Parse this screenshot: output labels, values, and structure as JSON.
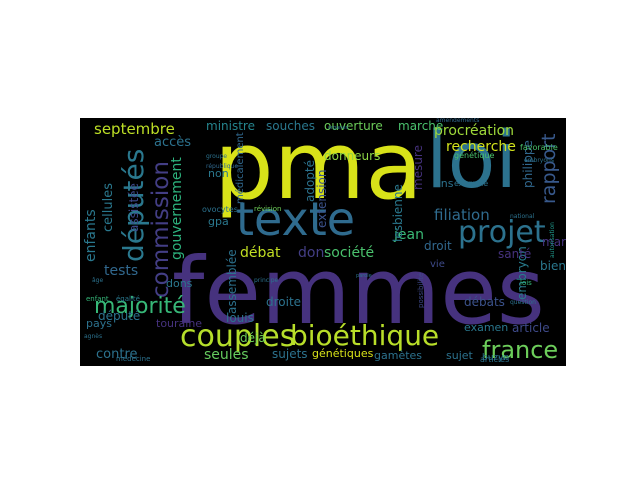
{
  "wordcloud": {
    "background": "#000000",
    "words": [
      {
        "text": "pma",
        "color": "#d8e219"
      },
      {
        "text": "loi",
        "color": "#2c728e"
      },
      {
        "text": "femmes",
        "color": "#46327e"
      },
      {
        "text": "texte",
        "color": "#2f6b8e"
      },
      {
        "text": "députés",
        "color": "#2a788e"
      },
      {
        "text": "couples",
        "color": "#b5de2b"
      },
      {
        "text": "bioéthique",
        "color": "#b8de29"
      },
      {
        "text": "projet",
        "color": "#2c728e"
      },
      {
        "text": "commission",
        "color": "#433e85"
      },
      {
        "text": "majorité",
        "color": "#37b878"
      },
      {
        "text": "france",
        "color": "#6ccd5a"
      },
      {
        "text": "rapport",
        "color": "#38598c"
      },
      {
        "text": "procréation",
        "color": "#9fda3a"
      },
      {
        "text": "filiation",
        "color": "#2f6b8e"
      },
      {
        "text": "septembre",
        "color": "#bddf26"
      },
      {
        "text": "cellules",
        "color": "#2a788e"
      },
      {
        "text": "gouvernement",
        "color": "#2db27d"
      },
      {
        "text": "enfants",
        "color": "#2a788e"
      },
      {
        "text": "recherche",
        "color": "#d2e21b"
      },
      {
        "text": "société",
        "color": "#4ac16d"
      },
      {
        "text": "débat",
        "color": "#c2df23"
      },
      {
        "text": "don",
        "color": "#433e85"
      },
      {
        "text": "jean",
        "color": "#3aba76"
      },
      {
        "text": "tests",
        "color": "#31688e"
      },
      {
        "text": "député",
        "color": "#2c728e"
      },
      {
        "text": "article",
        "color": "#3e4a89"
      },
      {
        "text": "embryon",
        "color": "#287c8e"
      },
      {
        "text": "seules",
        "color": "#65cb5e"
      },
      {
        "text": "contre",
        "color": "#2c728e"
      },
      {
        "text": "débats",
        "color": "#3b528b"
      },
      {
        "text": "philippe",
        "color": "#31688e"
      },
      {
        "text": "accès",
        "color": "#2c728e"
      },
      {
        "text": "assistée",
        "color": "#3e4989"
      },
      {
        "text": "ministre",
        "color": "#25858e"
      },
      {
        "text": "souches",
        "color": "#2a788e"
      },
      {
        "text": "ouverture",
        "color": "#6ccd5a"
      },
      {
        "text": "marche",
        "color": "#4ac16d"
      },
      {
        "text": "donneurs",
        "color": "#8ed645"
      },
      {
        "text": "adopté",
        "color": "#2c728e"
      },
      {
        "text": "extension",
        "color": "#3b528b"
      },
      {
        "text": "lesbienne",
        "color": "#2a788e"
      },
      {
        "text": "mesure",
        "color": "#46327e"
      },
      {
        "text": "ans",
        "color": "#2c728e"
      },
      {
        "text": "droit",
        "color": "#31688e"
      },
      {
        "text": "santé",
        "color": "#46327e"
      },
      {
        "text": "bien",
        "color": "#2a788e"
      },
      {
        "text": "mardi",
        "color": "#46337e"
      },
      {
        "text": "dons",
        "color": "#2a788e"
      },
      {
        "text": "louis",
        "color": "#2c728e"
      },
      {
        "text": "déjà",
        "color": "#6ece58"
      },
      {
        "text": "droite",
        "color": "#2c728e"
      },
      {
        "text": "assemblée",
        "color": "#2c728e"
      },
      {
        "text": "touraine",
        "color": "#46327e"
      },
      {
        "text": "sujets",
        "color": "#2c728e"
      },
      {
        "text": "génétiques",
        "color": "#d8e219"
      },
      {
        "text": "gamètes",
        "color": "#2c728e"
      },
      {
        "text": "sujet",
        "color": "#2c728e"
      },
      {
        "text": "examen",
        "color": "#2a788e"
      },
      {
        "text": "pays",
        "color": "#2c728e"
      },
      {
        "text": "non",
        "color": "#2a788e"
      },
      {
        "text": "gpa",
        "color": "#2a788e"
      },
      {
        "text": "médicalement",
        "color": "#31688e"
      },
      {
        "text": "vie",
        "color": "#3e4a89"
      },
      {
        "text": "buzyn",
        "color": "#2a788e"
      },
      {
        "text": "articles",
        "color": "#2c728e"
      },
      {
        "text": "médecine",
        "color": "#2c728e"
      },
      {
        "text": "enfant",
        "color": "#35b779"
      },
      {
        "text": "égalité",
        "color": "#2a788e"
      },
      {
        "text": "ovocytes",
        "color": "#2c728e"
      },
      {
        "text": "révision",
        "color": "#6ece58"
      },
      {
        "text": "génétique",
        "color": "#4ac16d"
      },
      {
        "text": "exemple",
        "color": "#2c728e"
      },
      {
        "text": "favorable",
        "color": "#4ac16d"
      },
      {
        "text": "amendements",
        "color": "#31688e"
      },
      {
        "text": "question",
        "color": "#2c728e"
      },
      {
        "text": "lois",
        "color": "#35b779"
      },
      {
        "text": "possibilité",
        "color": "#3e4989"
      },
      {
        "text": "embryons",
        "color": "#2c728e"
      },
      {
        "text": "autorisation",
        "color": "#1f988b"
      },
      {
        "text": "national",
        "color": "#2c728e"
      },
      {
        "text": "principe",
        "color": "#2c728e"
      },
      {
        "text": "agnès",
        "color": "#2c728e"
      },
      {
        "text": "groupe",
        "color": "#2c728e"
      },
      {
        "text": "république",
        "color": "#31688e"
      },
      {
        "text": "organes",
        "color": "#2c728e"
      },
      {
        "text": "parole",
        "color": "#2c728e"
      },
      {
        "text": "âge",
        "color": "#2c728e"
      }
    ]
  }
}
